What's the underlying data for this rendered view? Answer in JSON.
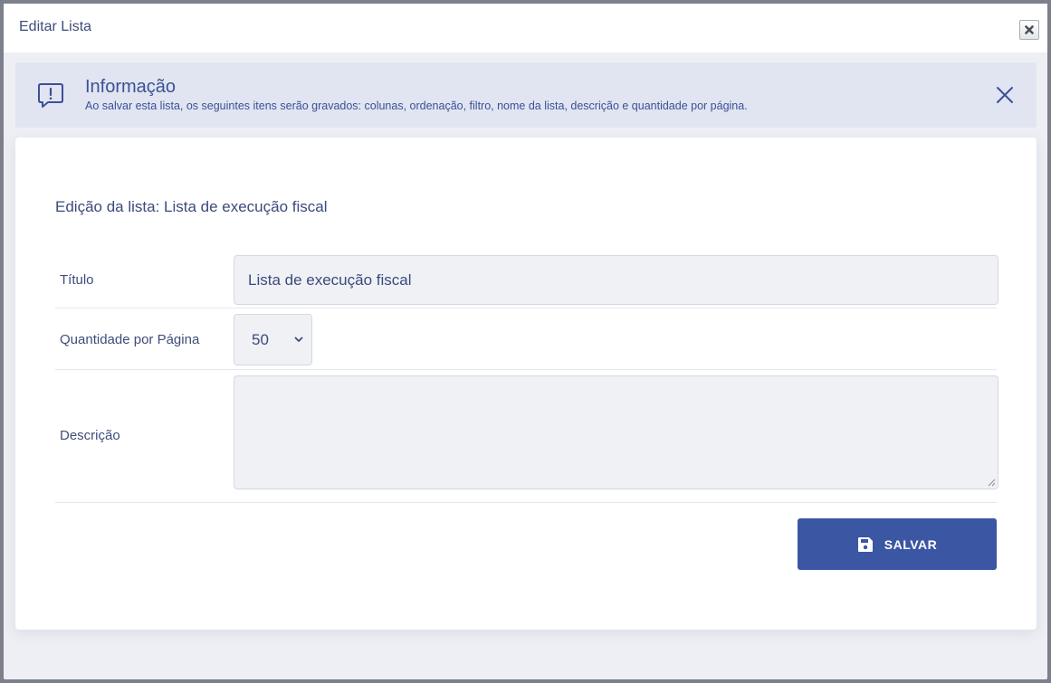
{
  "dialog": {
    "title": "Editar Lista",
    "close_icon": "close-icon"
  },
  "info": {
    "title": "Informação",
    "text": "Ao salvar esta lista, os seguintes itens serão gravados: colunas, ordenação, filtro, nome da lista, descrição e quantidade por página.",
    "icon": "message-alert-icon",
    "close_icon": "close-icon"
  },
  "form": {
    "heading": "Edição da lista: Lista de execução fiscal",
    "title_label": "Título",
    "title_value": "Lista de execução fiscal",
    "page_size_label": "Quantidade por Página",
    "page_size_value": "50",
    "description_label": "Descrição",
    "description_value": "",
    "save_label": "SALVAR",
    "save_icon": "floppy-disk-icon"
  },
  "colors": {
    "accent": "#3b56a2",
    "banner_bg": "#e0e5f1",
    "text": "#3f4d7a"
  }
}
